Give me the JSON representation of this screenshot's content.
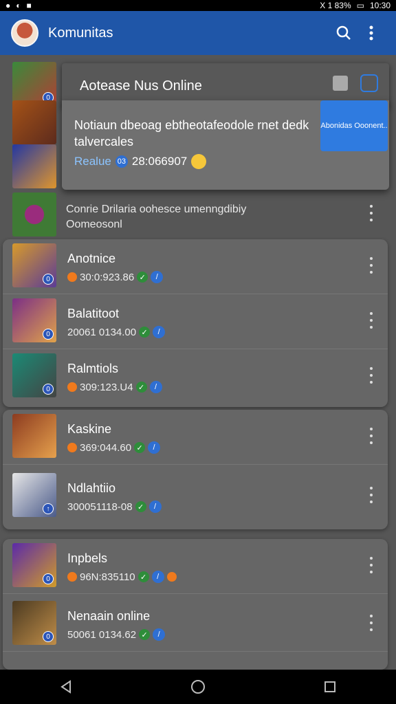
{
  "status_bar": {
    "left_icons": [
      "notification-icon",
      "whatsapp-icon",
      "app-icon"
    ],
    "right_text": "X 1 83%",
    "time": "10:30"
  },
  "appbar": {
    "title": "Komunitas",
    "icons": [
      "search-icon",
      "more-vertical-icon"
    ]
  },
  "popup": {
    "title": "Aotease Nus Online",
    "description": "Notiaun dbeoag ebtheotafeodole rnet dedk talvercales",
    "button_label": "Abonidas Ooonent..",
    "status_link": "Realue",
    "status_code": "03",
    "status_value": "28:066907"
  },
  "background": {
    "item_text_line1": "Conrie Drilaria oohesce umenngdibiy",
    "item_text_line2": "Oomeosonl"
  },
  "lists": [
    {
      "name": "Anotnice",
      "meta": "30:0:923.86",
      "icon": "orange"
    },
    {
      "name": "Balatitoot",
      "meta": "20061 0134.00",
      "icon": "none"
    },
    {
      "name": "Ralmtiols",
      "meta": "309:123.U4",
      "icon": "orange"
    },
    {
      "name": "Kaskine",
      "meta": "369:044.60",
      "icon": "orange"
    },
    {
      "name": "Ndlahtiio",
      "meta": "300051118-08",
      "icon": "none"
    },
    {
      "name": "Inpbels",
      "meta": "96N:835110",
      "icon": "orange"
    },
    {
      "name": "Nenaain online",
      "meta": "50061 0134.62",
      "icon": "none"
    }
  ],
  "navigation": {
    "back": "back-icon",
    "home": "home-icon",
    "recents": "recents-icon"
  },
  "colors": {
    "appbar": "#1f56a8",
    "accent_blue": "#2f7be0",
    "success": "#2e8d3a",
    "orange": "#f07a1d"
  }
}
